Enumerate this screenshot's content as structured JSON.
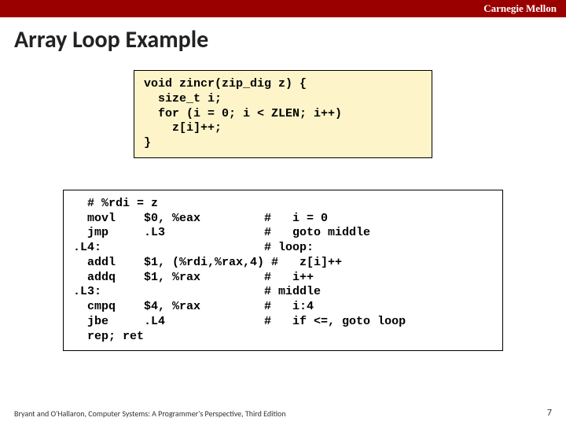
{
  "header": {
    "org": "Carnegie Mellon"
  },
  "title": "Array Loop Example",
  "code_c": "void zincr(zip_dig z) {\n  size_t i;\n  for (i = 0; i < ZLEN; i++)\n    z[i]++;\n}",
  "code_asm": "  # %rdi = z\n  movl    $0, %eax         #   i = 0\n  jmp     .L3              #   goto middle\n.L4:                       # loop:\n  addl    $1, (%rdi,%rax,4) #   z[i]++\n  addq    $1, %rax         #   i++\n.L3:                       # middle\n  cmpq    $4, %rax         #   i:4\n  jbe     .L4              #   if <=, goto loop\n  rep; ret",
  "footer": {
    "left": "Bryant and O'Hallaron, Computer Systems: A Programmer's Perspective, Third Edition",
    "page": "7"
  }
}
